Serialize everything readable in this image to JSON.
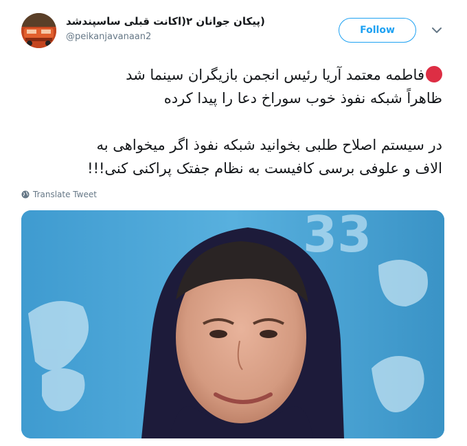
{
  "user": {
    "display_name": "(پیکان جوانان ۲(اکانت قبلی ساسپندشد",
    "handle": "@peikanjavanaan2"
  },
  "follow_button_label": "Follow",
  "tweet": {
    "lines": [
      "فاطمه معتمد آریا رئیس انجمن بازیگران سینما شد",
      "ظاهراً شبکه نفوذ خوب سوراخ دعا را پیدا کرده",
      "در سیستم اصلاح طلبی بخوانید شبکه نفوذ  اگر میخواهی به",
      "الاف و علوفی برسی کافیست به نظام جفتک پراکنی کنی!!!"
    ]
  },
  "translate_label": "Translate Tweet",
  "media_text": "33",
  "icons": {
    "avatar": "car-avatar",
    "red_dot": "red-circle-emoji",
    "chevron": "chevron-down-icon",
    "globe": "globe-icon"
  },
  "colors": {
    "accent": "#1da1f2",
    "text": "#14171a",
    "secondary": "#657786",
    "emoji_red": "#dd2e44"
  }
}
